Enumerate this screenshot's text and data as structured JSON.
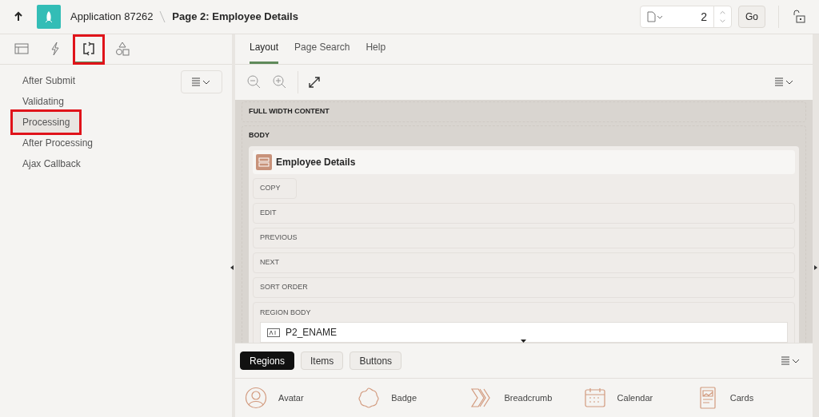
{
  "header": {
    "app": "Application 87262",
    "page": "Page 2: Employee Details",
    "page_number": "2",
    "go": "Go"
  },
  "left_tabs": [
    {
      "kind": "rendering",
      "selected": false,
      "annotated": false
    },
    {
      "kind": "dynamic",
      "selected": false,
      "annotated": false
    },
    {
      "kind": "processing",
      "selected": true,
      "annotated": true
    },
    {
      "kind": "shared",
      "selected": false,
      "annotated": false
    }
  ],
  "tree": [
    {
      "label": "After Submit",
      "selected": false,
      "annotated": false
    },
    {
      "label": "Validating",
      "selected": false,
      "annotated": false
    },
    {
      "label": "Processing",
      "selected": true,
      "annotated": true
    },
    {
      "label": "After Processing",
      "selected": false,
      "annotated": false
    },
    {
      "label": "Ajax Callback",
      "selected": false,
      "annotated": false
    }
  ],
  "tabs": [
    {
      "label": "Layout",
      "selected": true
    },
    {
      "label": "Page Search",
      "selected": false
    },
    {
      "label": "Help",
      "selected": false
    }
  ],
  "layout": {
    "sections": [
      "FULL WIDTH CONTENT",
      "BODY"
    ],
    "region": "Employee Details",
    "slots": [
      "COPY",
      "EDIT",
      "PREVIOUS",
      "NEXT",
      "SORT ORDER"
    ],
    "region_body": "REGION BODY",
    "item": "P2_ENAME"
  },
  "gallery_tabs": [
    {
      "label": "Regions",
      "selected": true
    },
    {
      "label": "Items",
      "selected": false
    },
    {
      "label": "Buttons",
      "selected": false
    }
  ],
  "components": [
    {
      "kind": "avatar",
      "label": "Avatar"
    },
    {
      "kind": "badge",
      "label": "Badge"
    },
    {
      "kind": "breadcrumb",
      "label": "Breadcrumb"
    },
    {
      "kind": "calendar",
      "label": "Calendar"
    },
    {
      "kind": "cards",
      "label": "Cards"
    }
  ]
}
